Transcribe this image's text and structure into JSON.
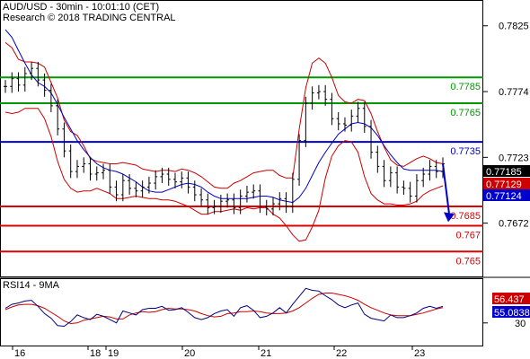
{
  "header": {
    "title": "AUD/USD - 30min - 10:01:10 (CET)",
    "copyright": "Research © 2018 TRADING CENTRAL"
  },
  "colors": {
    "green": "#009900",
    "red": "#e00000",
    "blue": "#0000cc",
    "bollinger": "#cc0000",
    "ma": "#0000cc",
    "price": "#000000",
    "rsi": "#000080",
    "rsi_ma": "#cc0000"
  },
  "chart_data": [
    {
      "type": "candlestick",
      "title": "AUD/USD - 30min",
      "y_ticks": [
        "0.7825",
        "0.7774",
        "0.7723",
        "0.7672"
      ],
      "x_ticks": [
        "16",
        "18",
        "19",
        "20",
        "21",
        "22",
        "23"
      ],
      "levels": [
        {
          "value": 0.7785,
          "label": "0.7785",
          "color": "#009900"
        },
        {
          "value": 0.7765,
          "label": "0.7765",
          "color": "#009900"
        },
        {
          "value": 0.7735,
          "label": "0.7735",
          "color": "#0000cc"
        },
        {
          "value": 0.7685,
          "label": "0.7685",
          "color": "#e00000"
        },
        {
          "value": 0.767,
          "label": "0.767",
          "color": "#e00000"
        },
        {
          "value": 0.765,
          "label": "0.765",
          "color": "#e00000"
        }
      ],
      "price_tags": [
        {
          "label": "0.77185",
          "bg": "#000000"
        },
        {
          "label": "0.77129",
          "bg": "#cc0000"
        },
        {
          "label": "0.77124",
          "bg": "#0000cc"
        }
      ],
      "close": [
        0.7778,
        0.7784,
        0.7779,
        0.7788,
        0.7792,
        0.7783,
        0.7775,
        0.7763,
        0.7745,
        0.7728,
        0.7712,
        0.7716,
        0.7718,
        0.771,
        0.7711,
        0.7713,
        0.77,
        0.7694,
        0.7705,
        0.7699,
        0.7697,
        0.77,
        0.7703,
        0.7708,
        0.771,
        0.7706,
        0.7704,
        0.7707,
        0.77,
        0.7694,
        0.769,
        0.7684,
        0.7685,
        0.7689,
        0.769,
        0.7684,
        0.7693,
        0.7696,
        0.7697,
        0.7685,
        0.7683,
        0.7687,
        0.7691,
        0.7685,
        0.7706,
        0.7736,
        0.7765,
        0.7773,
        0.7774,
        0.7768,
        0.7753,
        0.7749,
        0.7748,
        0.7755,
        0.7761,
        0.7747,
        0.7727,
        0.7716,
        0.7705,
        0.7711,
        0.77,
        0.7699,
        0.7693,
        0.7705,
        0.771,
        0.7716,
        0.7712,
        0.7718
      ],
      "bollinger_upper": [
        0.7812,
        0.7808,
        0.7799,
        0.7797,
        0.7797,
        0.7796,
        0.7793,
        0.7781,
        0.7769,
        0.7752,
        0.7743,
        0.774,
        0.7732,
        0.7722,
        0.772,
        0.7719,
        0.7718,
        0.7718,
        0.7719,
        0.7718,
        0.7717,
        0.7714,
        0.7713,
        0.7712,
        0.7713,
        0.7713,
        0.7712,
        0.7714,
        0.7713,
        0.7711,
        0.7708,
        0.7704,
        0.77,
        0.7699,
        0.7699,
        0.7703,
        0.7705,
        0.7708,
        0.7711,
        0.7712,
        0.7713,
        0.7713,
        0.7709,
        0.7707,
        0.7707,
        0.7745,
        0.7777,
        0.7796,
        0.78,
        0.7796,
        0.7785,
        0.7771,
        0.7766,
        0.7765,
        0.7768,
        0.7767,
        0.7757,
        0.7743,
        0.7731,
        0.7721,
        0.7717,
        0.7716,
        0.7719,
        0.7722,
        0.7724,
        0.7722,
        0.7719,
        0.7718
      ],
      "bollinger_lower": [
        0.7758,
        0.7757,
        0.7758,
        0.7761,
        0.7761,
        0.7761,
        0.7753,
        0.7739,
        0.772,
        0.7706,
        0.7699,
        0.7696,
        0.7697,
        0.7697,
        0.7699,
        0.7697,
        0.7695,
        0.7691,
        0.7691,
        0.7692,
        0.7693,
        0.7692,
        0.7691,
        0.7691,
        0.769,
        0.769,
        0.7689,
        0.7687,
        0.7685,
        0.7682,
        0.7679,
        0.7679,
        0.7681,
        0.7681,
        0.7682,
        0.7683,
        0.7682,
        0.7684,
        0.7683,
        0.7684,
        0.7684,
        0.7679,
        0.7676,
        0.767,
        0.7663,
        0.7658,
        0.7659,
        0.7669,
        0.7682,
        0.7707,
        0.7724,
        0.7732,
        0.7736,
        0.7735,
        0.7727,
        0.7708,
        0.7695,
        0.769,
        0.7687,
        0.7687,
        0.7686,
        0.7686,
        0.7687,
        0.7689,
        0.7694,
        0.7697,
        0.7699,
        0.7701
      ],
      "moving_average": [
        0.7822,
        0.7816,
        0.7806,
        0.7796,
        0.7787,
        0.7781,
        0.7778,
        0.7773,
        0.7764,
        0.7754,
        0.7745,
        0.7736,
        0.7729,
        0.7723,
        0.7718,
        0.7715,
        0.7713,
        0.7712,
        0.771,
        0.7707,
        0.7704,
        0.77,
        0.7697,
        0.7696,
        0.7696,
        0.7698,
        0.77,
        0.7702,
        0.7703,
        0.7702,
        0.77,
        0.7696,
        0.7693,
        0.7691,
        0.7691,
        0.7691,
        0.7691,
        0.7691,
        0.7692,
        0.7693,
        0.7693,
        0.7692,
        0.769,
        0.7689,
        0.7688,
        0.7692,
        0.7699,
        0.7709,
        0.7719,
        0.7727,
        0.7734,
        0.7741,
        0.7745,
        0.7749,
        0.775,
        0.7749,
        0.7746,
        0.774,
        0.7732,
        0.7725,
        0.7719,
        0.7714,
        0.7713,
        0.7713,
        0.7713,
        0.7713,
        0.7713,
        0.7712
      ]
    },
    {
      "type": "line",
      "title": "RSI14 - 9MA",
      "y_ticks": [
        "30"
      ],
      "price_tags": [
        {
          "label": "56.437",
          "bg": "#cc0000"
        },
        {
          "label": "55.0838",
          "bg": "#0000cc"
        }
      ],
      "series": [
        {
          "name": "RSI14",
          "values": [
            52,
            58,
            60,
            63,
            64,
            55,
            44,
            37,
            26,
            25,
            32,
            42,
            38,
            35,
            43,
            40,
            35,
            30,
            48,
            45,
            42,
            50,
            52,
            52,
            55,
            49,
            50,
            53,
            46,
            38,
            35,
            38,
            44,
            48,
            50,
            40,
            53,
            56,
            49,
            38,
            40,
            45,
            53,
            45,
            58,
            70,
            82,
            79,
            78,
            71,
            65,
            57,
            53,
            57,
            60,
            43,
            37,
            35,
            33,
            42,
            38,
            38,
            41,
            45,
            52,
            55,
            52,
            55
          ]
        },
        {
          "name": "9MA",
          "values": [
            50,
            54,
            57,
            58,
            58,
            56,
            52,
            46,
            40,
            33,
            29,
            30,
            34,
            36,
            38,
            40,
            39,
            36,
            36,
            42,
            45,
            47,
            46,
            47,
            50,
            52,
            51,
            51,
            50,
            48,
            44,
            41,
            39,
            40,
            44,
            45,
            47,
            47,
            48,
            47,
            45,
            44,
            44,
            45,
            48,
            53,
            60,
            67,
            73,
            75,
            75,
            73,
            71,
            68,
            64,
            58,
            53,
            49,
            45,
            42,
            41,
            41,
            41,
            43,
            45,
            48,
            51,
            53
          ]
        }
      ]
    }
  ]
}
